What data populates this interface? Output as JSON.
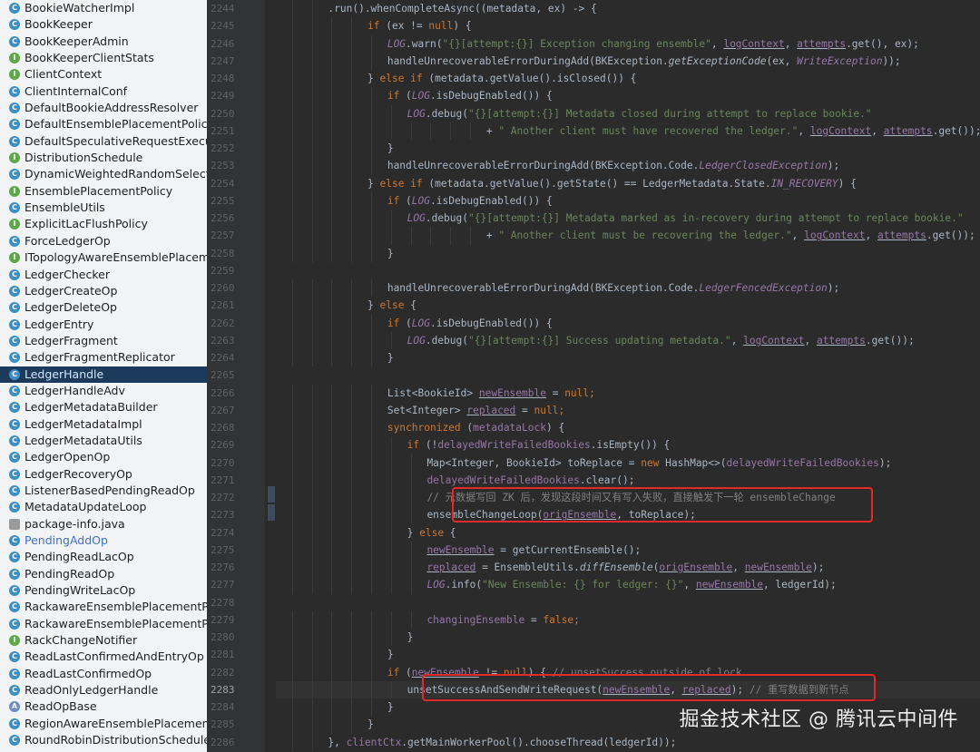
{
  "sidebar": {
    "items": [
      {
        "label": "BookieWatcherImpl",
        "icon": "class-icon",
        "kind": "c"
      },
      {
        "label": "BookKeeper",
        "icon": "class-icon",
        "kind": "c"
      },
      {
        "label": "BookKeeperAdmin",
        "icon": "class-icon",
        "kind": "c"
      },
      {
        "label": "BookKeeperClientStats",
        "icon": "interface-icon",
        "kind": "i"
      },
      {
        "label": "ClientContext",
        "icon": "interface-icon",
        "kind": "i"
      },
      {
        "label": "ClientInternalConf",
        "icon": "class-icon",
        "kind": "c"
      },
      {
        "label": "DefaultBookieAddressResolver",
        "icon": "class-icon",
        "kind": "c"
      },
      {
        "label": "DefaultEnsemblePlacementPolicy",
        "icon": "class-icon",
        "kind": "c"
      },
      {
        "label": "DefaultSpeculativeRequestExecution",
        "icon": "class-icon",
        "kind": "c"
      },
      {
        "label": "DistributionSchedule",
        "icon": "interface-icon",
        "kind": "i"
      },
      {
        "label": "DynamicWeightedRandomSelectionImpl",
        "icon": "class-icon",
        "kind": "c"
      },
      {
        "label": "EnsemblePlacementPolicy",
        "icon": "interface-icon",
        "kind": "i"
      },
      {
        "label": "EnsembleUtils",
        "icon": "class-icon",
        "kind": "c"
      },
      {
        "label": "ExplicitLacFlushPolicy",
        "icon": "interface-icon",
        "kind": "i"
      },
      {
        "label": "ForceLedgerOp",
        "icon": "class-icon",
        "kind": "c"
      },
      {
        "label": "ITopologyAwareEnsemblePlacementPolicy",
        "icon": "interface-icon",
        "kind": "i"
      },
      {
        "label": "LedgerChecker",
        "icon": "class-icon",
        "kind": "c"
      },
      {
        "label": "LedgerCreateOp",
        "icon": "class-icon",
        "kind": "c"
      },
      {
        "label": "LedgerDeleteOp",
        "icon": "class-icon",
        "kind": "c"
      },
      {
        "label": "LedgerEntry",
        "icon": "class-icon",
        "kind": "c"
      },
      {
        "label": "LedgerFragment",
        "icon": "class-icon",
        "kind": "c"
      },
      {
        "label": "LedgerFragmentReplicator",
        "icon": "class-icon",
        "kind": "c"
      },
      {
        "label": "LedgerHandle",
        "icon": "class-icon",
        "kind": "c",
        "selected": true
      },
      {
        "label": "LedgerHandleAdv",
        "icon": "class-icon",
        "kind": "c"
      },
      {
        "label": "LedgerMetadataBuilder",
        "icon": "class-icon",
        "kind": "c"
      },
      {
        "label": "LedgerMetadataImpl",
        "icon": "class-icon",
        "kind": "c"
      },
      {
        "label": "LedgerMetadataUtils",
        "icon": "class-icon",
        "kind": "c"
      },
      {
        "label": "LedgerOpenOp",
        "icon": "class-icon",
        "kind": "c"
      },
      {
        "label": "LedgerRecoveryOp",
        "icon": "class-icon",
        "kind": "c"
      },
      {
        "label": "ListenerBasedPendingReadOp",
        "icon": "class-icon",
        "kind": "c"
      },
      {
        "label": "MetadataUpdateLoop",
        "icon": "class-icon",
        "kind": "c"
      },
      {
        "label": "package-info.java",
        "icon": "package-file-icon",
        "kind": "p"
      },
      {
        "label": "PendingAddOp",
        "icon": "class-icon",
        "kind": "c",
        "vcs": true
      },
      {
        "label": "PendingReadLacOp",
        "icon": "class-icon",
        "kind": "c"
      },
      {
        "label": "PendingReadOp",
        "icon": "class-icon",
        "kind": "c"
      },
      {
        "label": "PendingWriteLacOp",
        "icon": "class-icon",
        "kind": "c"
      },
      {
        "label": "RackawareEnsemblePlacementPolicy",
        "icon": "class-icon",
        "kind": "c"
      },
      {
        "label": "RackawareEnsemblePlacementPolicyImpl",
        "icon": "class-icon",
        "kind": "c"
      },
      {
        "label": "RackChangeNotifier",
        "icon": "interface-icon",
        "kind": "i"
      },
      {
        "label": "ReadLastConfirmedAndEntryOp",
        "icon": "class-icon",
        "kind": "c"
      },
      {
        "label": "ReadLastConfirmedOp",
        "icon": "class-icon",
        "kind": "c"
      },
      {
        "label": "ReadOnlyLedgerHandle",
        "icon": "class-icon",
        "kind": "c"
      },
      {
        "label": "ReadOpBase",
        "icon": "abstract-class-icon",
        "kind": "a"
      },
      {
        "label": "RegionAwareEnsemblePlacementPolicy",
        "icon": "class-icon",
        "kind": "c"
      },
      {
        "label": "RoundRobinDistributionSchedule",
        "icon": "class-icon",
        "kind": "c"
      }
    ]
  },
  "editor": {
    "current_line": "2283",
    "lines": [
      {
        "n": "2244",
        "indent": 6,
        "tokens": [
          [
            ".run().whenCompleteAsync((metadata, ex) -> {",
            ""
          ]
        ]
      },
      {
        "n": "2245",
        "indent": 10,
        "tokens": [
          [
            "if",
            "kw"
          ],
          [
            " (ex != ",
            ""
          ],
          [
            "null",
            "kw"
          ],
          [
            ") {",
            ""
          ]
        ]
      },
      {
        "n": "2246",
        "indent": 12,
        "tokens": [
          [
            "LOG",
            "field"
          ],
          [
            ".warn(",
            ""
          ],
          [
            "\"{}[attempt:{}] Exception changing ensemble\"",
            "str"
          ],
          [
            ", ",
            ""
          ],
          [
            "logContext",
            "local-ul"
          ],
          [
            ", ",
            ""
          ],
          [
            "attempts",
            "local-ul"
          ],
          [
            ".get(), ex);",
            ""
          ]
        ]
      },
      {
        "n": "2247",
        "indent": 12,
        "tokens": [
          [
            "handleUnrecoverableErrorDuringAdd(BKException.",
            ""
          ],
          [
            "getExceptionCode",
            "italmethod"
          ],
          [
            "(ex, ",
            ""
          ],
          [
            "WriteException",
            "ital"
          ],
          [
            "));",
            ""
          ]
        ]
      },
      {
        "n": "2248",
        "indent": 10,
        "tokens": [
          [
            "} ",
            ""
          ],
          [
            "else if",
            "kw"
          ],
          [
            " (metadata.getValue().isClosed()) {",
            ""
          ]
        ]
      },
      {
        "n": "2249",
        "indent": 12,
        "tokens": [
          [
            "if",
            "kw"
          ],
          [
            " (",
            ""
          ],
          [
            "LOG",
            "field"
          ],
          [
            ".isDebugEnabled()) {",
            ""
          ]
        ]
      },
      {
        "n": "2250",
        "indent": 14,
        "tokens": [
          [
            "LOG",
            "field"
          ],
          [
            ".debug(",
            ""
          ],
          [
            "\"{}[attempt:{}] Metadata closed during attempt to replace bookie.\"",
            "str"
          ]
        ]
      },
      {
        "n": "2251",
        "indent": 22,
        "tokens": [
          [
            "+ ",
            ""
          ],
          [
            "\" Another client must have recovered the ledger.\"",
            "str"
          ],
          [
            ", ",
            ""
          ],
          [
            "logContext",
            "local-ul"
          ],
          [
            ", ",
            ""
          ],
          [
            "attempts",
            "local-ul"
          ],
          [
            ".get());",
            ""
          ]
        ]
      },
      {
        "n": "2252",
        "indent": 12,
        "tokens": [
          [
            "}",
            ""
          ]
        ]
      },
      {
        "n": "2253",
        "indent": 12,
        "tokens": [
          [
            "handleUnrecoverableErrorDuringAdd(BKException.Code.",
            ""
          ],
          [
            "LedgerClosedException",
            "ital"
          ],
          [
            ");",
            ""
          ]
        ]
      },
      {
        "n": "2254",
        "indent": 10,
        "tokens": [
          [
            "} ",
            ""
          ],
          [
            "else if",
            "kw"
          ],
          [
            " (metadata.getValue().getState() == LedgerMetadata.State.",
            ""
          ],
          [
            "IN_RECOVERY",
            "ital"
          ],
          [
            ") {",
            ""
          ]
        ]
      },
      {
        "n": "2255",
        "indent": 12,
        "tokens": [
          [
            "if",
            "kw"
          ],
          [
            " (",
            ""
          ],
          [
            "LOG",
            "field"
          ],
          [
            ".isDebugEnabled()) {",
            ""
          ]
        ]
      },
      {
        "n": "2256",
        "indent": 14,
        "tokens": [
          [
            "LOG",
            "field"
          ],
          [
            ".debug(",
            ""
          ],
          [
            "\"{}[attempt:{}] Metadata marked as in-recovery during attempt to replace bookie.\"",
            "str"
          ]
        ]
      },
      {
        "n": "2257",
        "indent": 22,
        "tokens": [
          [
            "+ ",
            ""
          ],
          [
            "\" Another client must be recovering the ledger.\"",
            "str"
          ],
          [
            ", ",
            ""
          ],
          [
            "logContext",
            "local-ul"
          ],
          [
            ", ",
            ""
          ],
          [
            "attempts",
            "local-ul"
          ],
          [
            ".get());",
            ""
          ]
        ]
      },
      {
        "n": "2258",
        "indent": 12,
        "tokens": [
          [
            "}",
            ""
          ]
        ]
      },
      {
        "n": "2259",
        "indent": 0,
        "tokens": []
      },
      {
        "n": "2260",
        "indent": 12,
        "tokens": [
          [
            "handleUnrecoverableErrorDuringAdd(BKException.Code.",
            ""
          ],
          [
            "LedgerFencedException",
            "ital"
          ],
          [
            ");",
            ""
          ]
        ]
      },
      {
        "n": "2261",
        "indent": 10,
        "tokens": [
          [
            "} ",
            ""
          ],
          [
            "else",
            "kw"
          ],
          [
            " {",
            ""
          ]
        ]
      },
      {
        "n": "2262",
        "indent": 12,
        "tokens": [
          [
            "if",
            "kw"
          ],
          [
            " (",
            ""
          ],
          [
            "LOG",
            "field"
          ],
          [
            ".isDebugEnabled()) {",
            ""
          ]
        ]
      },
      {
        "n": "2263",
        "indent": 14,
        "tokens": [
          [
            "LOG",
            "field"
          ],
          [
            ".debug(",
            ""
          ],
          [
            "\"{}[attempt:{}] Success updating metadata.\"",
            "str"
          ],
          [
            ", ",
            ""
          ],
          [
            "logContext",
            "local-ul"
          ],
          [
            ", ",
            ""
          ],
          [
            "attempts",
            "local-ul"
          ],
          [
            ".get());",
            ""
          ]
        ]
      },
      {
        "n": "2264",
        "indent": 12,
        "tokens": [
          [
            "}",
            ""
          ]
        ]
      },
      {
        "n": "2265",
        "indent": 0,
        "tokens": []
      },
      {
        "n": "2266",
        "indent": 12,
        "tokens": [
          [
            "List<BookieId> ",
            ""
          ],
          [
            "newEnsemble",
            "local-ul"
          ],
          [
            " = ",
            ""
          ],
          [
            "null",
            "kw"
          ],
          [
            ";",
            "kw"
          ]
        ]
      },
      {
        "n": "2267",
        "indent": 12,
        "tokens": [
          [
            "Set<Integer> ",
            ""
          ],
          [
            "replaced",
            "local-ul"
          ],
          [
            " = ",
            ""
          ],
          [
            "null",
            "kw"
          ],
          [
            ";",
            "kw"
          ]
        ]
      },
      {
        "n": "2268",
        "indent": 12,
        "tokens": [
          [
            "synchronized",
            "kw"
          ],
          [
            " (",
            ""
          ],
          [
            "metadataLock",
            "local"
          ],
          [
            ") {",
            ""
          ]
        ]
      },
      {
        "n": "2269",
        "indent": 14,
        "tokens": [
          [
            "if",
            "kw"
          ],
          [
            " (!",
            ""
          ],
          [
            "delayedWriteFailedBookies",
            "local"
          ],
          [
            ".isEmpty()) {",
            ""
          ]
        ]
      },
      {
        "n": "2270",
        "indent": 16,
        "tokens": [
          [
            "Map<Integer, BookieId> toReplace = ",
            ""
          ],
          [
            "new",
            "kw"
          ],
          [
            " HashMap<>(",
            ""
          ],
          [
            "delayedWriteFailedBookies",
            "local"
          ],
          [
            ");",
            ""
          ]
        ]
      },
      {
        "n": "2271",
        "indent": 16,
        "tokens": [
          [
            "delayedWriteFailedBookies",
            "local"
          ],
          [
            ".clear();",
            ""
          ]
        ]
      },
      {
        "n": "2272",
        "indent": 16,
        "tokens": [
          [
            "// 元数据写回 ZK 后，发现这段时间又有写入失败，直接触发下一轮 ensembleChange",
            "cmt"
          ]
        ]
      },
      {
        "n": "2273",
        "indent": 16,
        "tokens": [
          [
            "ensembleChangeLoop(",
            ""
          ],
          [
            "origEnsemble",
            "local-ul"
          ],
          [
            ", toReplace);",
            ""
          ]
        ]
      },
      {
        "n": "2274",
        "indent": 14,
        "tokens": [
          [
            "} ",
            ""
          ],
          [
            "else",
            "kw"
          ],
          [
            " {",
            ""
          ]
        ]
      },
      {
        "n": "2275",
        "indent": 16,
        "tokens": [
          [
            "newEnsemble",
            "local-ul"
          ],
          [
            " = getCurrentEnsemble();",
            ""
          ]
        ]
      },
      {
        "n": "2276",
        "indent": 16,
        "tokens": [
          [
            "replaced",
            "local-ul"
          ],
          [
            " = EnsembleUtils.",
            ""
          ],
          [
            "diffEnsemble",
            "italmethod"
          ],
          [
            "(",
            ""
          ],
          [
            "origEnsemble",
            "local-ul"
          ],
          [
            ", ",
            ""
          ],
          [
            "newEnsemble",
            "local-ul"
          ],
          [
            ");",
            ""
          ]
        ]
      },
      {
        "n": "2277",
        "indent": 16,
        "tokens": [
          [
            "LOG",
            "field"
          ],
          [
            ".info(",
            ""
          ],
          [
            "\"New Ensemble: {} for ledger: {}\"",
            "str"
          ],
          [
            ", ",
            ""
          ],
          [
            "newEnsemble",
            "local-ul"
          ],
          [
            ", ledgerId);",
            ""
          ]
        ]
      },
      {
        "n": "2278",
        "indent": 0,
        "tokens": []
      },
      {
        "n": "2279",
        "indent": 16,
        "tokens": [
          [
            "changingEnsemble",
            "local"
          ],
          [
            " = ",
            ""
          ],
          [
            "false",
            "kw"
          ],
          [
            ";",
            "kw"
          ]
        ]
      },
      {
        "n": "2280",
        "indent": 14,
        "tokens": [
          [
            "}",
            ""
          ]
        ]
      },
      {
        "n": "2281",
        "indent": 12,
        "tokens": [
          [
            "}",
            ""
          ]
        ]
      },
      {
        "n": "2282",
        "indent": 12,
        "tokens": [
          [
            "if",
            "kw"
          ],
          [
            " (",
            ""
          ],
          [
            "newEnsemble",
            "local-ul"
          ],
          [
            " != ",
            ""
          ],
          [
            "null",
            "kw"
          ],
          [
            ") { ",
            ""
          ],
          [
            "// unsetSuccess outside of lock",
            "cmt"
          ]
        ]
      },
      {
        "n": "2283",
        "indent": 14,
        "tokens": [
          [
            "unsetSuccessAndSendWriteRequest(",
            ""
          ],
          [
            "newEnsemble",
            "local-ul"
          ],
          [
            ", ",
            ""
          ],
          [
            "replaced",
            "local-ul"
          ],
          [
            "); ",
            ""
          ],
          [
            "// 重写数据到新节点",
            "cmt"
          ]
        ]
      },
      {
        "n": "2284",
        "indent": 12,
        "tokens": [
          [
            "}",
            ""
          ]
        ]
      },
      {
        "n": "2285",
        "indent": 10,
        "tokens": [
          [
            "}",
            ""
          ]
        ]
      },
      {
        "n": "2286",
        "indent": 6,
        "tokens": [
          [
            "}, ",
            ""
          ],
          [
            "clientCtx",
            "local"
          ],
          [
            ".getMainWorkerPool().chooseThread(ledgerId));",
            ""
          ]
        ]
      }
    ]
  },
  "watermark": {
    "text": "掘金技术社区 @ 腾讯云中间件"
  },
  "colors": {
    "editor_bg": "#2b2b2b",
    "gutter_bg": "#313335",
    "sidebar_bg": "#f2f3f5",
    "selection_bg": "#1c3a5c",
    "highlight_box": "#e32a2a",
    "keyword": "#cc7832",
    "string": "#6a8759",
    "field": "#9876aa",
    "comment": "#808080"
  }
}
